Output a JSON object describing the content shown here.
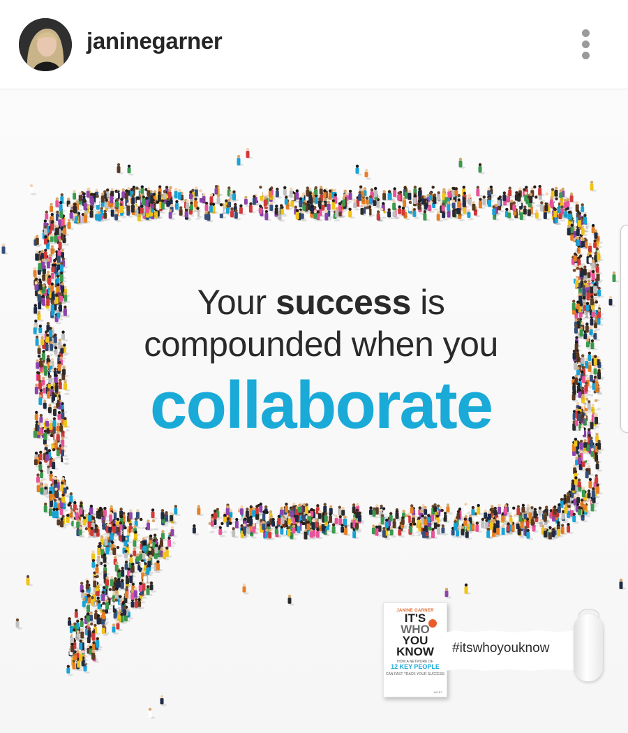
{
  "post": {
    "username": "janinegarner",
    "avatar_icon": "profile-photo-avatar",
    "more_icon": "vertical-ellipsis-icon"
  },
  "image": {
    "headline": {
      "line1_before": "Your ",
      "line1_bold": "success",
      "line1_after": " is",
      "line2": "compounded when you",
      "line3": "collaborate"
    },
    "book": {
      "author": "JANINE GARNER",
      "title_1": "IT'S",
      "title_2": "WHO",
      "title_3": "YOU",
      "title_4": "KNOW",
      "subtitle": "HOW A NETWORK OF",
      "people": "12 KEY PEOPLE",
      "tagline": "CAN FAST-TRACK YOUR SUCCESS",
      "publisher": "WILEY"
    },
    "hashtag": "#itswhoyouknow",
    "colors": {
      "accent_blue": "#1aaad8",
      "text_dark": "#2a2a2a",
      "book_orange": "#ea5b2b"
    }
  }
}
